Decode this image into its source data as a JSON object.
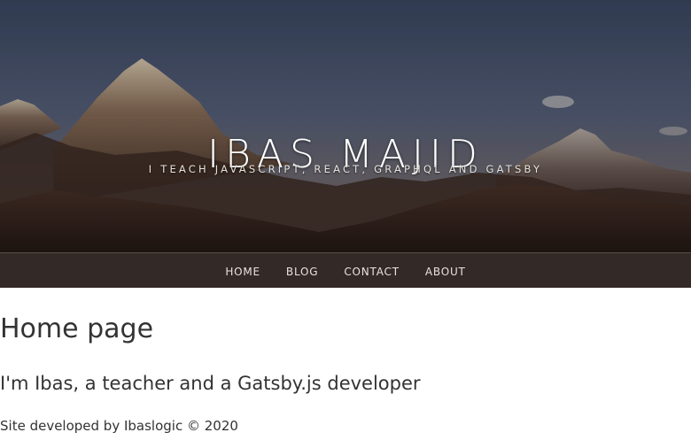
{
  "header": {
    "title": "IBAS MAJID",
    "subtitle": "I TEACH JAVASCRIPT, REACT, GRAPHQL AND GATSBY"
  },
  "nav": {
    "items": [
      {
        "label": "HOME"
      },
      {
        "label": "BLOG"
      },
      {
        "label": "CONTACT"
      },
      {
        "label": "ABOUT"
      }
    ]
  },
  "main": {
    "page_title": "Home page",
    "intro": "I'm Ibas, a teacher and a Gatsby.js developer"
  },
  "footer": {
    "text": "Site developed by Ibaslogic © 2020"
  },
  "colors": {
    "nav_background": "#332926",
    "text": "#333333",
    "hero_text": "#ffffff"
  }
}
